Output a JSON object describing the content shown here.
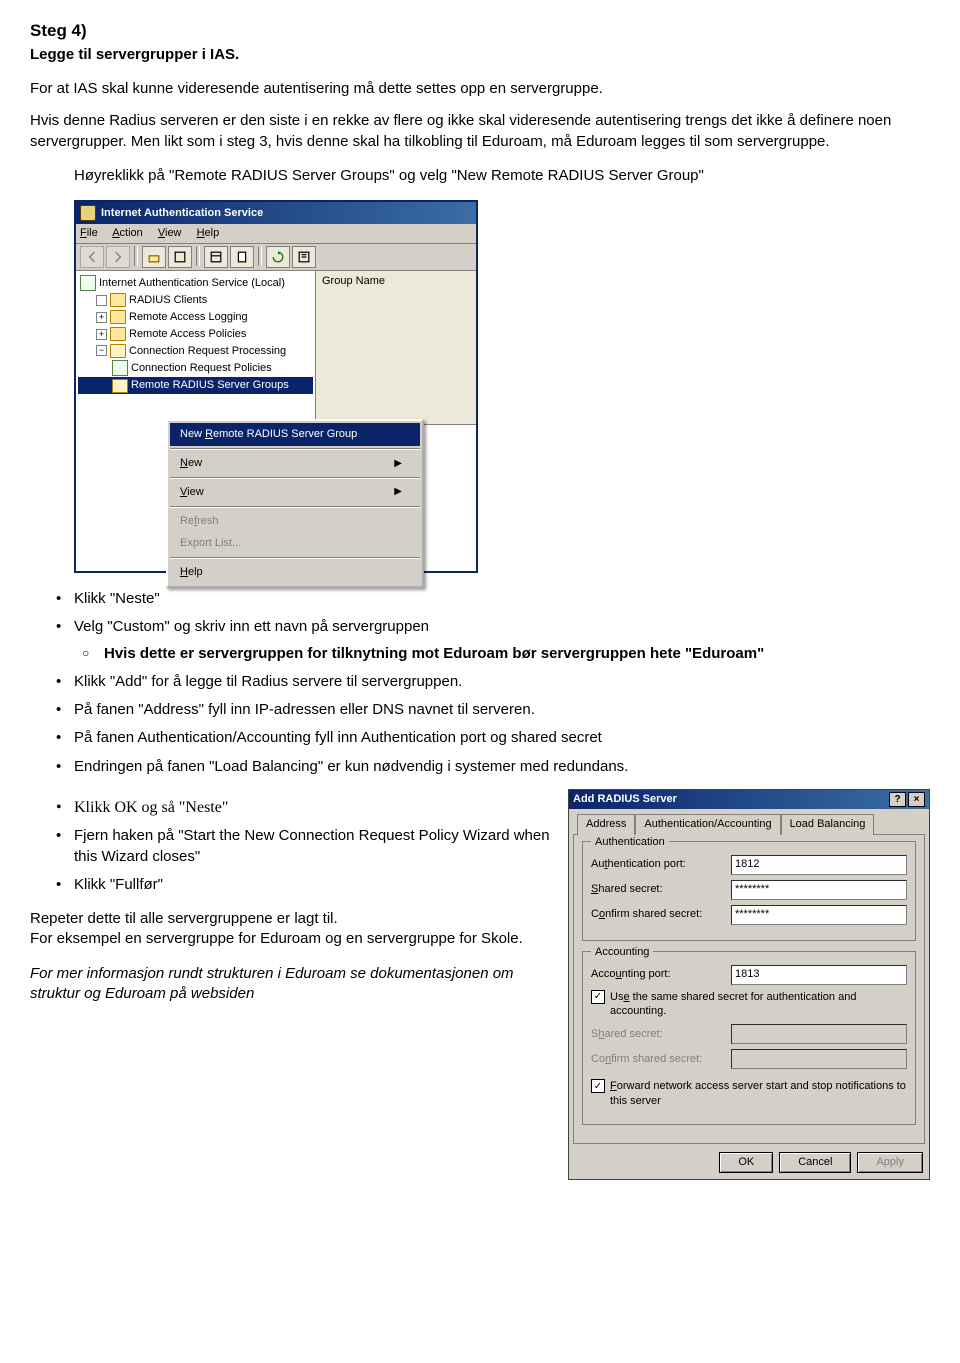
{
  "heading": "Steg 4)",
  "subheading": "Legge til servergrupper i IAS.",
  "para1": "For at IAS skal kunne videresende autentisering må dette settes opp en servergruppe.",
  "para2": "Hvis denne Radius serveren er den siste i en rekke av flere og ikke skal videresende autentisering trengs det ikke å definere noen servergrupper. Men likt som i steg 3, hvis denne skal ha tilkobling til Eduroam, må Eduroam legges til som servergruppe.",
  "instr": "Høyreklikk på \"Remote RADIUS Server Groups\" og velg \"New Remote RADIUS Server Group\"",
  "mmc": {
    "title": "Internet Authentication Service",
    "menu": {
      "file": "File",
      "action": "Action",
      "view": "View",
      "help": "Help"
    },
    "tree": {
      "root": "Internet Authentication Service (Local)",
      "n1": "RADIUS Clients",
      "n2": "Remote Access Logging",
      "n3": "Remote Access Policies",
      "n4": "Connection Request Processing",
      "n4a": "Connection Request Policies",
      "n4b": "Remote RADIUS Server Groups"
    },
    "colHeader": "Group Name",
    "ctx": {
      "newGroup": "New Remote RADIUS Server Group",
      "new": "New",
      "view": "View",
      "refresh": "Refresh",
      "export": "Export List...",
      "help": "Help"
    }
  },
  "bullets": {
    "b1": "Klikk \"Neste\"",
    "b2": "Velg \"Custom\" og skriv inn ett navn på servergruppen",
    "b2a": "Hvis dette er servergruppen for tilknytning mot Eduroam bør servergruppen hete \"Eduroam\"",
    "b3": "Klikk \"Add\" for å legge til Radius servere til servergruppen.",
    "b4": "På fanen \"Address\" fyll inn IP-adressen eller DNS navnet til serveren.",
    "b5": "På fanen Authentication/Accounting fyll inn Authentication port og shared secret",
    "b6": "Endringen på fanen \"Load Balancing\" er kun nødvendig i systemer med redundans.",
    "b7": "Klikk OK og så \"Neste\"",
    "b8": "Fjern haken på \"Start the New Connection Request Policy Wizard when this Wizard closes\"",
    "b9": "Klikk \"Fullfør\""
  },
  "outro": {
    "p1": "Repeter dette til alle servergruppene er lagt til.",
    "p2": "For eksempel en servergruppe for Eduroam og en servergruppe for Skole.",
    "p3": "For mer informasjon rundt strukturen i Eduroam se dokumentasjonen om struktur og Eduroam på websiden"
  },
  "dlg": {
    "title": "Add RADIUS Server",
    "tabs": {
      "t1": "Address",
      "t2": "Authentication/Accounting",
      "t3": "Load Balancing"
    },
    "auth": {
      "legend": "Authentication",
      "portLabel": "Authentication port:",
      "portValue": "1812",
      "secretLabel": "Shared secret:",
      "secretValue": "********",
      "confirmLabel": "Confirm shared secret:",
      "confirmValue": "********"
    },
    "acct": {
      "legend": "Accounting",
      "portLabel": "Accounting port:",
      "portValue": "1813",
      "sameLabel": "Use the same shared secret for authentication and accounting.",
      "secretLabel": "Shared secret:",
      "confirmLabel": "Confirm shared secret:",
      "fwdLabel": "Forward network access server start and stop notifications to this server"
    },
    "ok": "OK",
    "cancel": "Cancel",
    "apply": "Apply"
  }
}
